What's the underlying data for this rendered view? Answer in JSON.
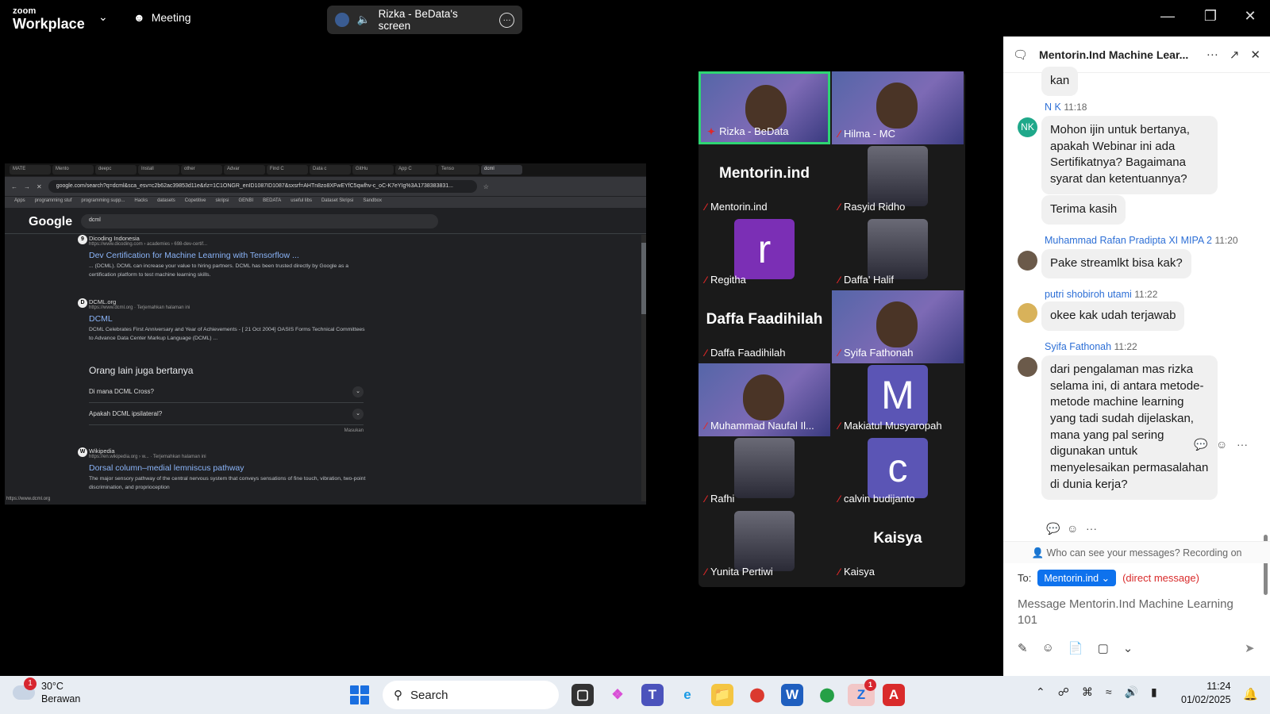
{
  "app": {
    "brand_top": "zoom",
    "brand_bottom": "Workplace",
    "meeting_label": "Meeting",
    "share_label": "Rizka - BeData's screen"
  },
  "browser": {
    "tabs": [
      "MATE",
      "Mento",
      "deepc",
      "Install",
      "other",
      "Advar",
      "Find C",
      "Data c",
      "GitHu",
      "App C",
      "Tenso",
      "dcml"
    ],
    "url": "google.com/search?q=dcml&sca_esv=c2b62ac39853d11e&rlz=1C1ONGR_enID1087ID1087&sxsrf=AHTn8zo8XFwEYfC5qwlhv-c_oC-K7eYIg%3A1738383831...",
    "bookmarks": [
      "Apps",
      "programming stuf",
      "programming supp...",
      "Hacks",
      "datasets",
      "Copetitive",
      "skripsi",
      "GENBI",
      "BEDATA",
      "useful libs",
      "Dataset Skripsi",
      "Sandbox"
    ],
    "google": "Google",
    "query": "dcml",
    "results": [
      {
        "icon": "9",
        "site": "Dicoding Indonesia",
        "crumb": "https://www.dicoding.com › academies › 698-dev-certif...",
        "title": "Dev Certification for Machine Learning with Tensorflow ...",
        "snippet": "... (DCML). DCML can increase your value to hiring partners. DCML has been trusted directly by Google as a certification platform to test machine learning skills."
      },
      {
        "icon": "D",
        "site": "DCML.org",
        "crumb": "https://www.dcml.org · Terjemahkan halaman ini",
        "title": "DCML",
        "snippet": "DCML Celebrates First Anniversary and Year of Achievements - [ 21 Oct 2004] OASIS Forms Technical Committees to Advance Data Center Markup Language (DCML) ..."
      },
      {
        "icon": "W",
        "site": "Wikipedia",
        "crumb": "https://en.wikipedia.org › w... · Terjemahkan halaman ini",
        "title": "Dorsal column–medial lemniscus pathway",
        "snippet": "The major sensory pathway of the central nervous system that conveys sensations of fine touch, vibration, two-point discrimination, and proprioception"
      }
    ],
    "paa_title": "Orang lain juga bertanya",
    "paa_questions": [
      "Di mana DCML Cross?",
      "Apakah DCML ipsilateral?"
    ],
    "paa_feedback": "Masukan",
    "status_url": "https://www.dcml.org"
  },
  "gallery": [
    {
      "name": "Rizka - BeData",
      "kind": "video",
      "highlight": true
    },
    {
      "name": "Hilma - MC",
      "kind": "video"
    },
    {
      "name": "Mentorin.ind",
      "kind": "text",
      "big": "Mentorin.ind"
    },
    {
      "name": "Rasyid Ridho",
      "kind": "photo"
    },
    {
      "name": "Regitha",
      "kind": "letter",
      "letter": "r",
      "color": "#7b2fb5"
    },
    {
      "name": "Daffa' Halif",
      "kind": "photo"
    },
    {
      "name": "Daffa Faadihilah",
      "kind": "text",
      "big": "Daffa Faadihilah"
    },
    {
      "name": "Syifa Fathonah",
      "kind": "video"
    },
    {
      "name": "Muhammad Naufal Il...",
      "kind": "video"
    },
    {
      "name": "Makiatul Musyaropah",
      "kind": "letter",
      "letter": "M",
      "color": "#5b55b5"
    },
    {
      "name": "Rafhi",
      "kind": "photo"
    },
    {
      "name": "calvin budijanto",
      "kind": "letter",
      "letter": "c",
      "color": "#5b55b5"
    },
    {
      "name": "Yunita Pertiwi",
      "kind": "photo"
    },
    {
      "name": "Kaisya",
      "kind": "text",
      "big": "Kaisya"
    }
  ],
  "chat": {
    "title": "Mentorin.Ind Machine Lear...",
    "messages": [
      {
        "text": "kan"
      },
      {
        "sender": "N K",
        "time": "11:18",
        "avatar": "NK",
        "avatar_color": "#1fa88a",
        "text": "Mohon ijin untuk bertanya, apakah Webinar ini ada Sertifikatnya? Bagaimana syarat dan ketentuannya?"
      },
      {
        "text": "Terima kasih"
      },
      {
        "sender": "Muhammad Rafan Pradipta XI MIPA 2",
        "time": "11:20",
        "text": "Pake streamlkt bisa kak?"
      },
      {
        "sender": "putri shobiroh utami",
        "time": "11:22",
        "avatar_color": "#d8b25a",
        "text": "okee kak udah terjawab"
      },
      {
        "sender": "Syifa Fathonah",
        "time": "11:22",
        "text": "dari pengalaman mas rizka selama ini, di antara metode-metode machine learning yang tadi sudah dijelaskan, mana yang pal sering digunakan untuk menyelesaikan permasalahan di dunia kerja?"
      }
    ],
    "visibility": "Who can see your messages? Recording on",
    "to_label": "To:",
    "to_value": "Mentorin.ind",
    "dm_label": "(direct message)",
    "placeholder": "Message Mentorin.Ind Machine Learning 101"
  },
  "taskbar": {
    "weather_badge": "1",
    "temp": "30°C",
    "weather": "Berawan",
    "search": "Search",
    "zoom_badge": "1",
    "time": "11:24",
    "date": "01/02/2025"
  }
}
